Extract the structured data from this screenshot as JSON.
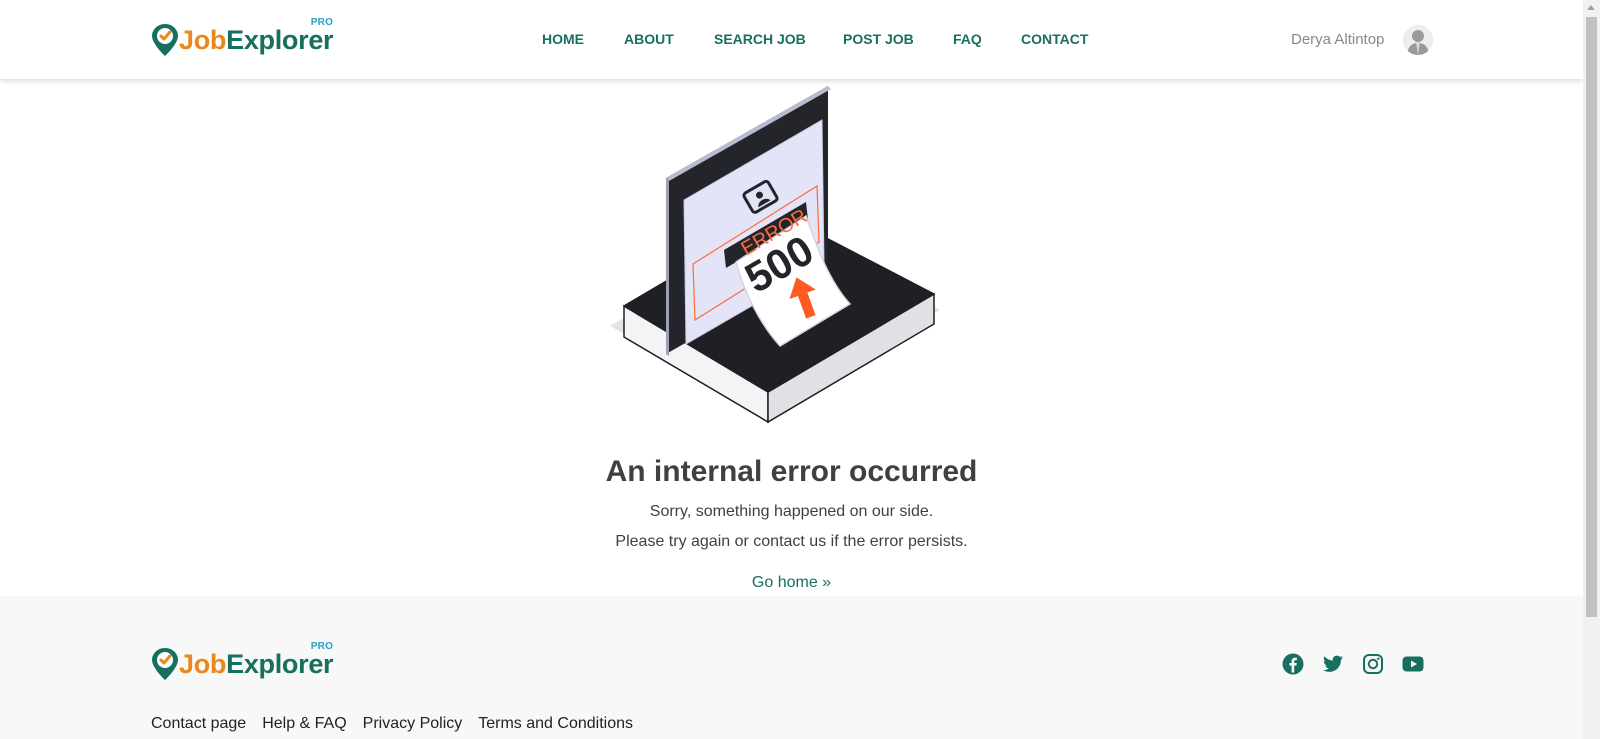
{
  "brand": {
    "part1": "Job",
    "part2": "Explorer",
    "badge": "PRO"
  },
  "nav": {
    "items": [
      {
        "label": "HOME"
      },
      {
        "label": "ABOUT"
      },
      {
        "label": "SEARCH JOB"
      },
      {
        "label": "POST JOB"
      },
      {
        "label": "FAQ"
      },
      {
        "label": "CONTACT"
      }
    ]
  },
  "user": {
    "name": "Derya Altintop"
  },
  "illustration": {
    "paper_label": "ERROR",
    "paper_code": "500"
  },
  "error": {
    "title": "An internal error occurred",
    "line1": "Sorry, something happened on our side.",
    "line2": "Please try again or contact us if the error persists.",
    "link": "Go home »"
  },
  "footer": {
    "social": [
      "facebook-icon",
      "twitter-icon",
      "instagram-icon",
      "youtube-icon"
    ],
    "links": [
      {
        "label": "Contact page"
      },
      {
        "label": "Help & FAQ"
      },
      {
        "label": "Privacy Policy"
      },
      {
        "label": "Terms and Conditions"
      }
    ]
  },
  "colors": {
    "brand_green": "#17705f",
    "brand_orange": "#e8891d",
    "error_orange": "#ff5a1f"
  }
}
